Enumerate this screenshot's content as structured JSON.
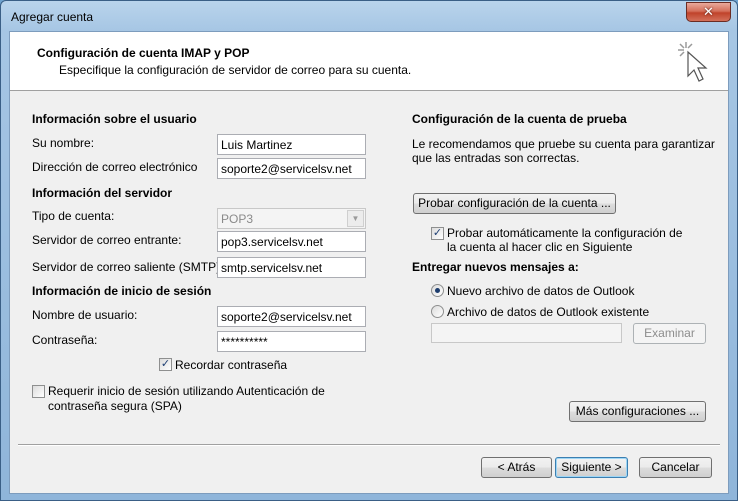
{
  "window": {
    "title": "Agregar cuenta",
    "close_label": "✕"
  },
  "header": {
    "title": "Configuración de cuenta IMAP y POP",
    "subtitle": "Especifique la configuración de servidor de correo para su cuenta."
  },
  "user_info": {
    "heading": "Información sobre el usuario",
    "name_label": "Su nombre:",
    "name_value": "Luis Martinez",
    "email_label": "Dirección de correo electrónico",
    "email_value": "soporte2@servicelsv.net"
  },
  "server_info": {
    "heading": "Información del servidor",
    "account_type_label": "Tipo de cuenta:",
    "account_type_value": "POP3",
    "incoming_label": "Servidor de correo entrante:",
    "incoming_value": "pop3.servicelsv.net",
    "outgoing_label": "Servidor de correo saliente (SMTP):",
    "outgoing_value": "smtp.servicelsv.net"
  },
  "login_info": {
    "heading": "Información de inicio de sesión",
    "username_label": "Nombre de usuario:",
    "username_value": "soporte2@servicelsv.net",
    "password_label": "Contraseña:",
    "password_value": "**********",
    "remember_label": "Recordar contraseña",
    "remember_checked": true,
    "spa_label_line1": "Requerir inicio de sesión utilizando Autenticación de",
    "spa_label_line2": "contraseña segura (SPA)",
    "spa_checked": false
  },
  "test": {
    "heading": "Configuración de la cuenta de prueba",
    "desc_line1": "Le recomendamos que pruebe su cuenta para garantizar",
    "desc_line2": "que las entradas son correctas.",
    "test_button": "Probar configuración de la cuenta ...",
    "auto_test_line1": "Probar automáticamente la configuración de",
    "auto_test_line2": "la cuenta al hacer clic en Siguiente",
    "auto_test_checked": true
  },
  "delivery": {
    "heading": "Entregar nuevos mensajes a:",
    "option_new": "Nuevo archivo de datos de Outlook",
    "option_existing": "Archivo de datos de Outlook existente",
    "selected": "new",
    "path_value": "",
    "browse_button": "Examinar"
  },
  "more_settings_button": "Más configuraciones ...",
  "footer": {
    "back_button": "< Atrás",
    "next_button": "Siguiente >",
    "cancel_button": "Cancelar"
  }
}
